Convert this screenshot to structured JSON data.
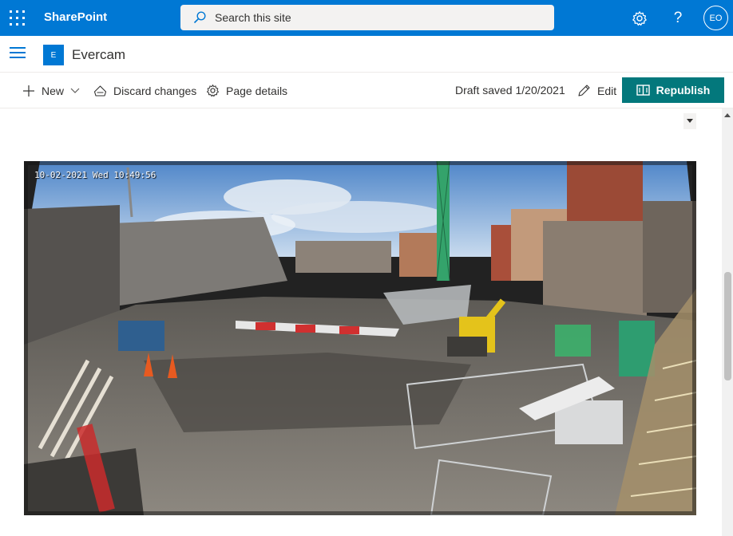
{
  "suitebar": {
    "brand": "SharePoint",
    "search_placeholder": "Search this site",
    "user_initials": "EO",
    "colors": {
      "background": "#0078d4"
    }
  },
  "site": {
    "logo_letter": "E",
    "title": "Evercam"
  },
  "commandbar": {
    "new_label": "New",
    "discard_label": "Discard changes",
    "page_details_label": "Page details",
    "draft_status": "Draft saved 1/20/2021",
    "edit_label": "Edit",
    "republish_label": "Republish",
    "colors": {
      "republish": "#03787c"
    }
  },
  "camera": {
    "timestamp": "10-02-2021 Wed 10:49:56"
  }
}
